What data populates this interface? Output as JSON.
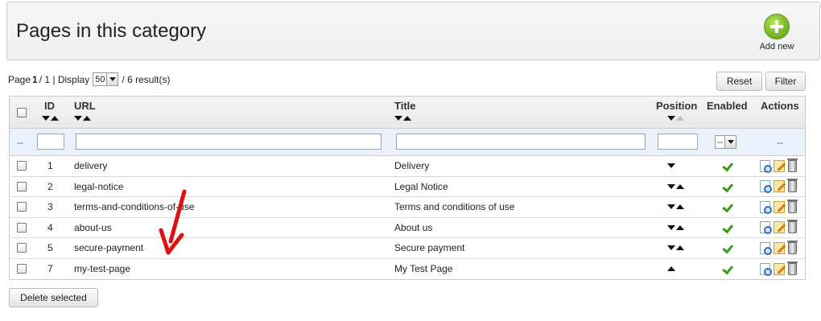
{
  "header": {
    "title": "Pages in this category",
    "add_new_label": "Add new"
  },
  "pagination": {
    "page_prefix": "Page",
    "page_current": "1",
    "page_sep": " / 1 | Display",
    "display_value": "50",
    "results_text": "/ 6 result(s)"
  },
  "toolbar": {
    "reset_label": "Reset",
    "filter_label": "Filter",
    "delete_label": "Delete selected"
  },
  "columns": {
    "id": "ID",
    "url": "URL",
    "title": "Title",
    "position": "Position",
    "enabled": "Enabled",
    "actions": "Actions"
  },
  "filter": {
    "placeholder_dash": "--",
    "enabled_value": "--",
    "actions_dash": "--"
  },
  "rows": [
    {
      "id": "1",
      "url": "delivery",
      "title": "Delivery",
      "position_arrows": "down",
      "enabled": true
    },
    {
      "id": "2",
      "url": "legal-notice",
      "title": "Legal Notice",
      "position_arrows": "both",
      "enabled": true
    },
    {
      "id": "3",
      "url": "terms-and-conditions-of-use",
      "title": "Terms and conditions of use",
      "position_arrows": "both",
      "enabled": true
    },
    {
      "id": "4",
      "url": "about-us",
      "title": "About us",
      "position_arrows": "both",
      "enabled": true
    },
    {
      "id": "5",
      "url": "secure-payment",
      "title": "Secure payment",
      "position_arrows": "both",
      "enabled": true
    },
    {
      "id": "7",
      "url": "my-test-page",
      "title": "My Test Page",
      "position_arrows": "up",
      "enabled": true
    }
  ],
  "colors": {
    "accent_green": "#6fad1e",
    "annotation_arrow": "#e01010",
    "filter_row_bg": "#eaf1fb"
  }
}
